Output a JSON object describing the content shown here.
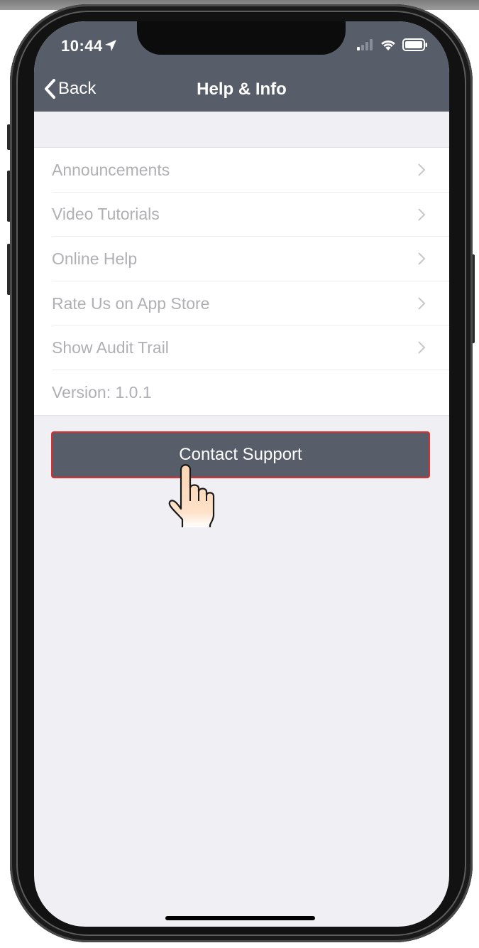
{
  "status_bar": {
    "time": "10:44"
  },
  "nav": {
    "back_label": "Back",
    "title": "Help & Info"
  },
  "menu": {
    "items": [
      {
        "label": "Announcements"
      },
      {
        "label": "Video Tutorials"
      },
      {
        "label": "Online Help"
      },
      {
        "label": "Rate Us on App Store"
      },
      {
        "label": "Show Audit Trail"
      }
    ],
    "version": "Version: 1.0.1"
  },
  "contact_button": {
    "label": "Contact Support"
  },
  "icons": {
    "back": "chevron-left-icon",
    "row": "chevron-right-icon",
    "location": "location-arrow-icon",
    "signal": "cellular-signal-icon",
    "wifi": "wifi-icon",
    "battery": "battery-icon",
    "pointer": "pointing-hand-icon"
  },
  "colors": {
    "header": "#585d6a",
    "background": "#f0eff4",
    "row_text": "#b0b0b4",
    "button": "#585d6a",
    "highlight_border": "#e02c2c"
  }
}
